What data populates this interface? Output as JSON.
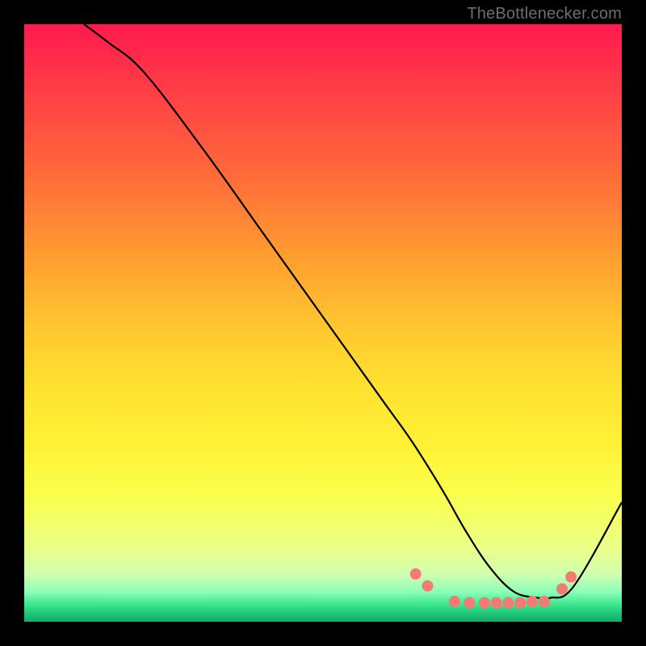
{
  "attribution": "TheBottlenecker.com",
  "chart_data": {
    "type": "line",
    "title": "",
    "xlabel": "",
    "ylabel": "",
    "xlim": [
      0,
      100
    ],
    "ylim": [
      0,
      100
    ],
    "series": [
      {
        "name": "curve",
        "x": [
          10,
          14,
          20,
          30,
          40,
          50,
          60,
          65,
          70,
          74,
          78,
          82,
          86,
          88,
          92,
          100
        ],
        "y": [
          100,
          97,
          92,
          79,
          65,
          51,
          37,
          30,
          22,
          15,
          9,
          5,
          4,
          4,
          6,
          20
        ]
      }
    ],
    "markers": [
      {
        "x": 65.5,
        "y": 8.0
      },
      {
        "x": 67.5,
        "y": 6.0
      },
      {
        "x": 72.0,
        "y": 3.4
      },
      {
        "x": 74.5,
        "y": 3.2
      },
      {
        "x": 77.0,
        "y": 3.2
      },
      {
        "x": 79.0,
        "y": 3.2
      },
      {
        "x": 81.0,
        "y": 3.2
      },
      {
        "x": 83.0,
        "y": 3.2
      },
      {
        "x": 85.0,
        "y": 3.4
      },
      {
        "x": 87.0,
        "y": 3.4
      },
      {
        "x": 90.0,
        "y": 5.5
      },
      {
        "x": 91.5,
        "y": 7.5
      }
    ],
    "marker_color": "#f47b73",
    "marker_radius": 7,
    "line_color": "#000000",
    "line_width": 2.2
  }
}
